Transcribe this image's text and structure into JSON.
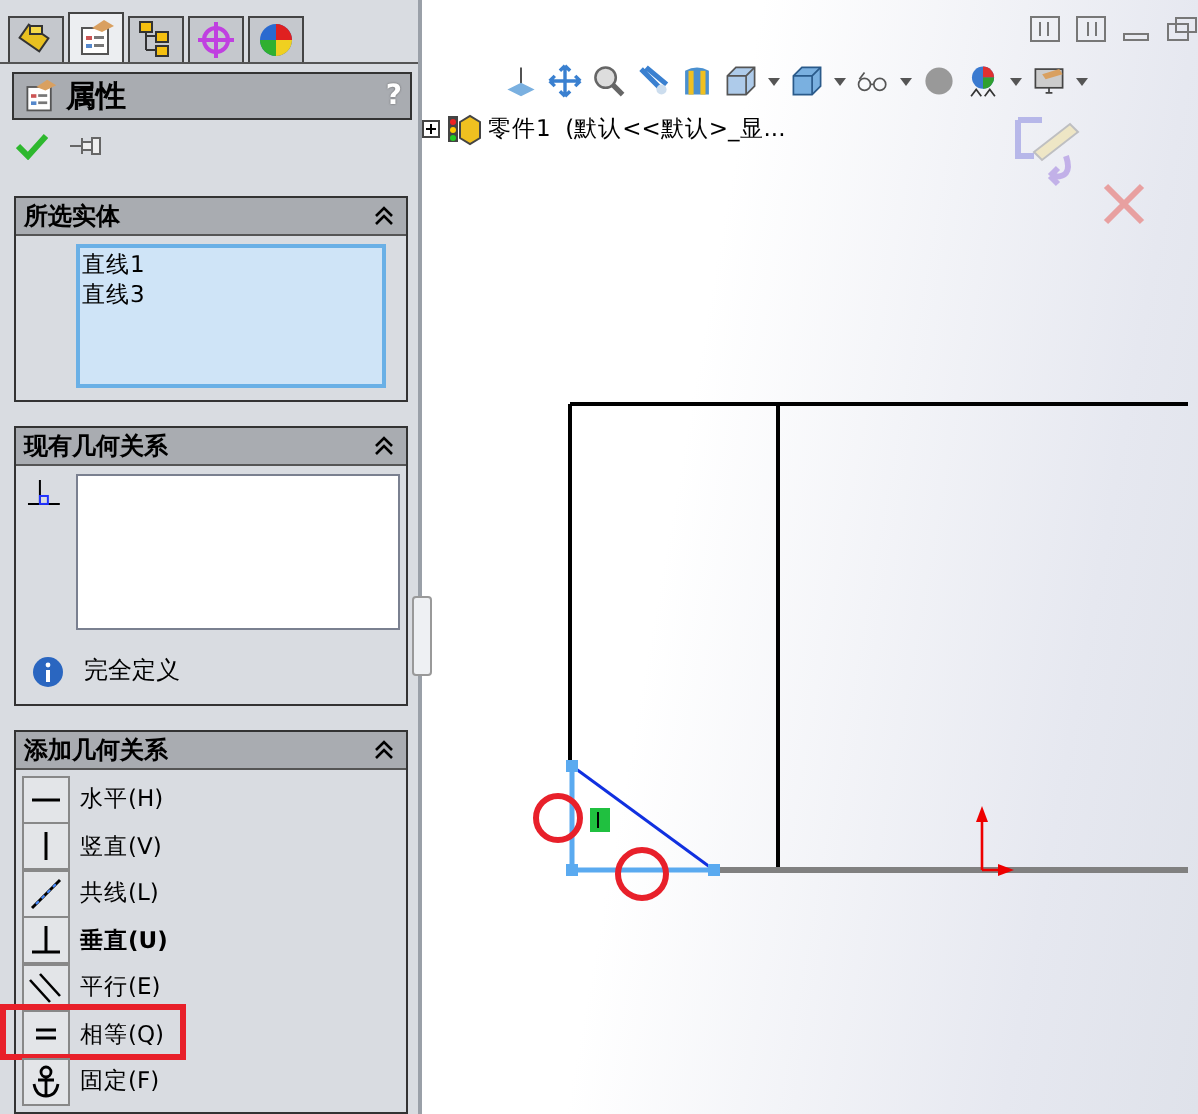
{
  "tabs": [
    {
      "kind": "feature",
      "selected": false
    },
    {
      "kind": "property",
      "selected": true
    },
    {
      "kind": "config",
      "selected": false
    },
    {
      "kind": "dimxpert",
      "selected": false
    },
    {
      "kind": "display",
      "selected": false
    }
  ],
  "panel": {
    "title": "属性",
    "help": "?"
  },
  "selected_entities": {
    "title": "所选实体",
    "items": [
      "直线1",
      "直线3"
    ]
  },
  "existing_relations": {
    "title": "现有几何关系",
    "status": "完全定义"
  },
  "add_relations": {
    "title": "添加几何关系",
    "items": [
      {
        "kind": "horizontal",
        "label": "水平(H)",
        "bold": false,
        "highlighted": false
      },
      {
        "kind": "vertical",
        "label": "竖直(V)",
        "bold": false,
        "highlighted": false
      },
      {
        "kind": "collinear",
        "label": "共线(L)",
        "bold": false,
        "highlighted": false
      },
      {
        "kind": "perpendicular",
        "label": "垂直(U)",
        "bold": true,
        "highlighted": false
      },
      {
        "kind": "parallel",
        "label": "平行(E)",
        "bold": false,
        "highlighted": false
      },
      {
        "kind": "equal",
        "label": "相等(Q)",
        "bold": false,
        "highlighted": true
      },
      {
        "kind": "fix",
        "label": "固定(F)",
        "bold": false,
        "highlighted": false
      }
    ]
  },
  "graphics": {
    "tree_item": "零件1  (默认<<默认>_显..."
  }
}
